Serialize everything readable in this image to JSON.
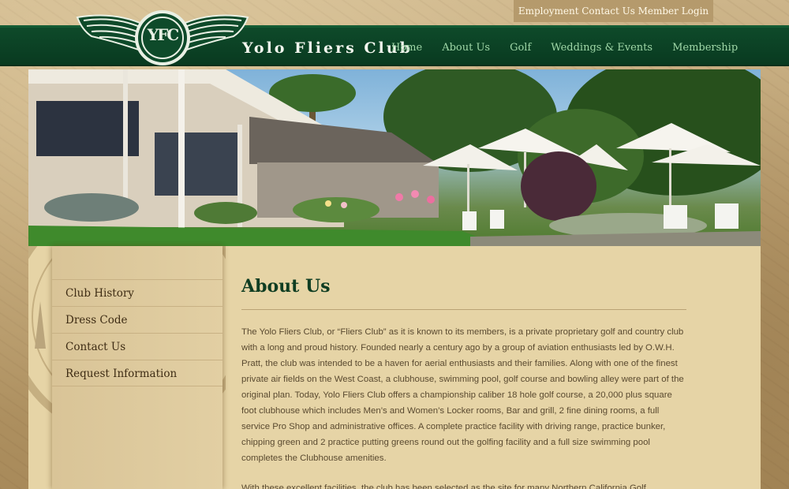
{
  "utility_nav": [
    "Employment",
    "Contact Us",
    "Member Login"
  ],
  "site_title": "Yolo Fliers Club",
  "logo_text": "YFC",
  "main_nav": [
    "Home",
    "About Us",
    "Golf",
    "Weddings & Events",
    "Membership"
  ],
  "sidebar": {
    "items": [
      "Club History",
      "Dress Code",
      "Contact Us",
      "Request Information"
    ]
  },
  "main": {
    "title": "About Us",
    "paragraphs": [
      "The Yolo Fliers Club, or “Fliers Club” as it is known to its members, is a private proprietary golf and country club with a long and proud history. Founded nearly a century ago by a group of aviation enthusiasts led by O.W.H. Pratt, the club was intended to be a haven for aerial enthusiasts and their families. Along with one of the finest private air fields on the West Coast, a clubhouse, swimming pool, golf course and bowling alley were part of the original plan. Today, Yolo Fliers Club offers a championship caliber 18 hole golf course, a 20,000 plus square foot clubhouse which includes Men’s and Women’s Locker rooms, Bar and grill, 2 fine dining rooms, a full service Pro Shop and administrative offices. A complete practice facility with driving range, practice bunker, chipping green and 2 practice putting greens round out the golfing facility and a full size swimming pool completes the Clubhouse amenities.",
      "With these excellent facilities, the club has been selected as the site for many Northern California Golf Association"
    ]
  },
  "colors": {
    "nav_green": "#0e4a2a",
    "nav_link": "#9fd7a7",
    "title_green": "#0f3d22",
    "parchment": "#e6d4a6"
  }
}
